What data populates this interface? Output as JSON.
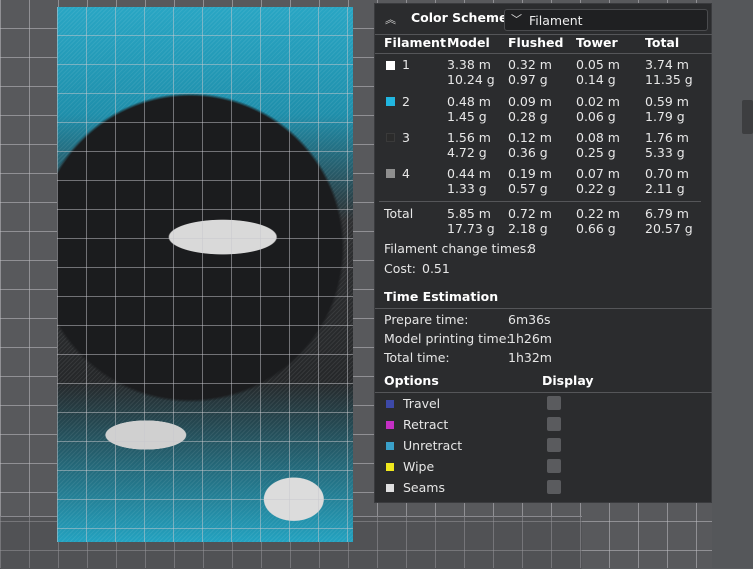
{
  "color_scheme": {
    "title": "Color Scheme",
    "selected": "Filament"
  },
  "table": {
    "headers": [
      "Filament",
      "Model",
      "Flushed",
      "Tower",
      "Total"
    ],
    "rows": [
      {
        "id": "1",
        "color": "#ffffff",
        "model": "3.38 m\n10.24 g",
        "flushed": "0.32 m\n0.97 g",
        "tower": "0.05 m\n0.14 g",
        "total": "3.74 m\n11.35 g"
      },
      {
        "id": "2",
        "color": "#21b6e0",
        "model": "0.48 m\n1.45 g",
        "flushed": "0.09 m\n0.28 g",
        "tower": "0.02 m\n0.06 g",
        "total": "0.59 m\n1.79 g"
      },
      {
        "id": "3",
        "color": "#2b2b2b",
        "model": "1.56 m\n4.72 g",
        "flushed": "0.12 m\n0.36 g",
        "tower": "0.08 m\n0.25 g",
        "total": "1.76 m\n5.33 g"
      },
      {
        "id": "4",
        "color": "#8f8f8f",
        "model": "0.44 m\n1.33 g",
        "flushed": "0.19 m\n0.57 g",
        "tower": "0.07 m\n0.22 g",
        "total": "0.70 m\n2.11 g"
      }
    ],
    "total": {
      "label": "Total",
      "model": "5.85 m\n17.73 g",
      "flushed": "0.72 m\n2.18 g",
      "tower": "0.22 m\n0.66 g",
      "total": "6.79 m\n20.57 g"
    }
  },
  "filament_change": {
    "label": "Filament change times:",
    "value": "8"
  },
  "cost": {
    "label": "Cost:",
    "value": "0.51"
  },
  "time_estimation": {
    "title": "Time Estimation",
    "rows": [
      {
        "label": "Prepare time:",
        "value": "6m36s"
      },
      {
        "label": "Model printing time:",
        "value": "1h26m"
      },
      {
        "label": "Total time:",
        "value": "1h32m"
      }
    ]
  },
  "options": {
    "title": "Options",
    "display_title": "Display",
    "items": [
      {
        "label": "Travel",
        "color": "#3d49a8"
      },
      {
        "label": "Retract",
        "color": "#c42fc4"
      },
      {
        "label": "Unretract",
        "color": "#3aa0c8"
      },
      {
        "label": "Wipe",
        "color": "#f0e81e"
      },
      {
        "label": "Seams",
        "color": "#e0e0e0"
      }
    ]
  }
}
